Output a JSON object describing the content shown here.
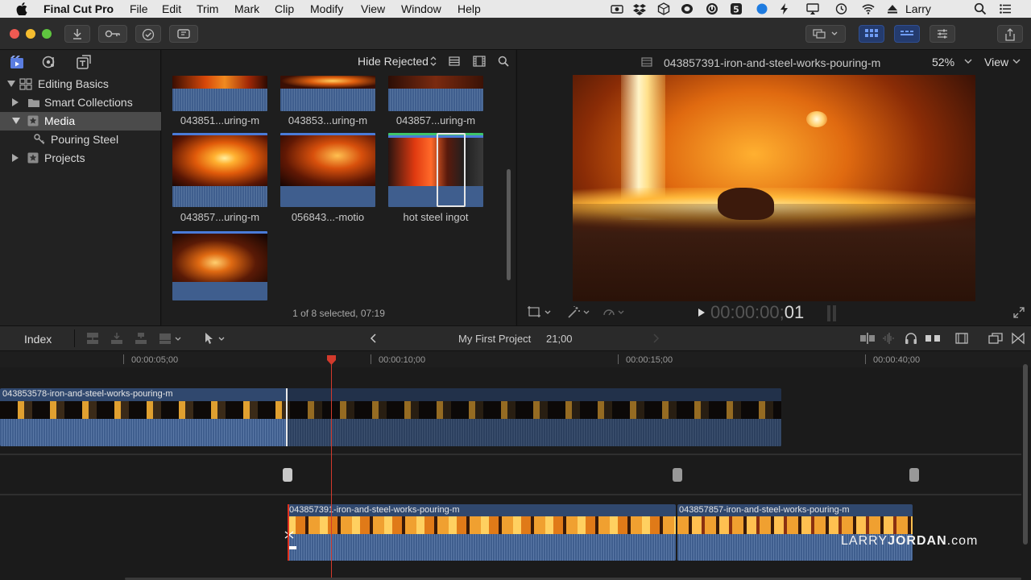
{
  "menubar": {
    "app": "Final Cut Pro",
    "items": [
      "File",
      "Edit",
      "Trim",
      "Mark",
      "Clip",
      "Modify",
      "View",
      "Window",
      "Help"
    ],
    "user": "Larry"
  },
  "library": {
    "rows": [
      {
        "label": "Editing Basics"
      },
      {
        "label": "Smart Collections"
      },
      {
        "label": "Media"
      },
      {
        "label": "Pouring Steel"
      },
      {
        "label": "Projects"
      }
    ]
  },
  "browser": {
    "filter": "Hide Rejected",
    "clips": [
      {
        "label": "043851...uring-m"
      },
      {
        "label": "043853...uring-m"
      },
      {
        "label": "043857...uring-m"
      },
      {
        "label": "043857...uring-m"
      },
      {
        "label": "056843...-motio"
      },
      {
        "label": "hot steel ingot"
      },
      {
        "label": ""
      }
    ],
    "status": "1 of 8 selected, 07:19"
  },
  "viewer": {
    "clip_name": "043857391-iron-and-steel-works-pouring-m",
    "zoom": "52%",
    "view_menu": "View",
    "timecode_dim": "00:00:00;",
    "timecode_bright": "01"
  },
  "timeline_bar": {
    "index_label": "Index",
    "project_name": "My First Project",
    "duration": "21;00"
  },
  "ruler": {
    "labels": [
      "00:00:05;00",
      "00:00:10;00",
      "00:00:15;00",
      "00:00:40;00"
    ]
  },
  "clips": {
    "upper": "043853578-iron-and-steel-works-pouring-m",
    "lower_a": "043857391-iron-and-steel-works-pouring-m",
    "lower_b": "043857857-iron-and-steel-works-pouring-m"
  },
  "watermark": {
    "part1": "LARRY",
    "part2": "JORDAN",
    "part3": ".com"
  },
  "colors": {
    "accent": "#4a7bd9",
    "playhead": "#d33a2c",
    "audio": "#3f5e8e",
    "selection": "#4b4b4b"
  }
}
